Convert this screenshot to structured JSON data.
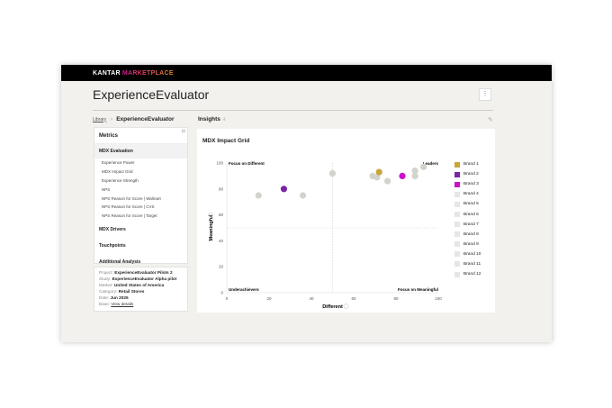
{
  "header": {
    "logo_kantar": "KANTAR",
    "logo_marketplace": "MARKETPLACE"
  },
  "page": {
    "title": "ExperienceEvaluator",
    "more_icon": "vertical-dots-icon"
  },
  "breadcrumb": {
    "library": "Library",
    "separator": ">",
    "current": "ExperienceEvaluator"
  },
  "insights": {
    "label": "Insights",
    "icon": "lightbulb-icon",
    "edit_icon": "edit-icon"
  },
  "metrics": {
    "title": "Metrics",
    "sections": [
      {
        "label": "MDX Evaluation",
        "active": true,
        "items": [
          "Experience Power",
          "MDX Impact Grid",
          "Experience Strength",
          "NPS",
          "NPS Reason for Score | Walmart",
          "NPS Reason for Score | CVS",
          "NPS Reason for Score | Target"
        ]
      },
      {
        "label": "MDX Drivers"
      },
      {
        "label": "Touchpoints"
      },
      {
        "label": "Additional Analysis"
      }
    ]
  },
  "info": [
    {
      "label": "Project:",
      "value": "ExperienceEvaluator Pilots 2"
    },
    {
      "label": "Study:",
      "value": "ExperienceEvaluator Alpha pilot"
    },
    {
      "label": "Market:",
      "value": "United States of America"
    },
    {
      "label": "Category:",
      "value": "Retail Stores"
    },
    {
      "label": "Date:",
      "value": "Jun 2025"
    },
    {
      "label": "Base:",
      "value": "View details",
      "link": true
    }
  ],
  "chart_data": {
    "title": "MDX Impact Grid",
    "type": "scatter",
    "xlabel": "Different",
    "ylabel": "Meaningful",
    "xlim": [
      0,
      100
    ],
    "ylim": [
      0,
      100
    ],
    "xticks": [
      0,
      20,
      40,
      60,
      80,
      100
    ],
    "yticks": [
      0,
      20,
      40,
      60,
      80,
      100
    ],
    "reference_lines": {
      "x": 50,
      "y": 50
    },
    "quadrants": {
      "top_left": "Focus on Different",
      "top_right": "Leaders",
      "bottom_left": "Underachievers",
      "bottom_right": "Focus on Meaningful"
    },
    "legend_position": "right",
    "series": [
      {
        "name": "Brand 1",
        "color": "#c9a53a",
        "x": 72,
        "y": 93
      },
      {
        "name": "Brand 2",
        "color": "#7a24a8",
        "x": 27,
        "y": 80
      },
      {
        "name": "Brand 3",
        "color": "#cc10cc",
        "x": 83,
        "y": 90
      },
      {
        "name": "Brand 4",
        "color": "#e6e6e6",
        "x": 15,
        "y": 75
      },
      {
        "name": "Brand 5",
        "color": "#e6e6e6",
        "x": 36,
        "y": 75
      },
      {
        "name": "Brand 6",
        "color": "#e6e6e6",
        "x": 50,
        "y": 92
      },
      {
        "name": "Brand 7",
        "color": "#e6e6e6",
        "x": 69,
        "y": 90
      },
      {
        "name": "Brand 8",
        "color": "#e6e6e6",
        "x": 71,
        "y": 89
      },
      {
        "name": "Brand 9",
        "color": "#e6e6e6",
        "x": 76,
        "y": 86
      },
      {
        "name": "Brand 10",
        "color": "#e6e6e6",
        "x": 89,
        "y": 94
      },
      {
        "name": "Brand 11",
        "color": "#e6e6e6",
        "x": 89,
        "y": 90
      },
      {
        "name": "Brand 12",
        "color": "#e6e6e6",
        "x": 93,
        "y": 97
      }
    ]
  }
}
